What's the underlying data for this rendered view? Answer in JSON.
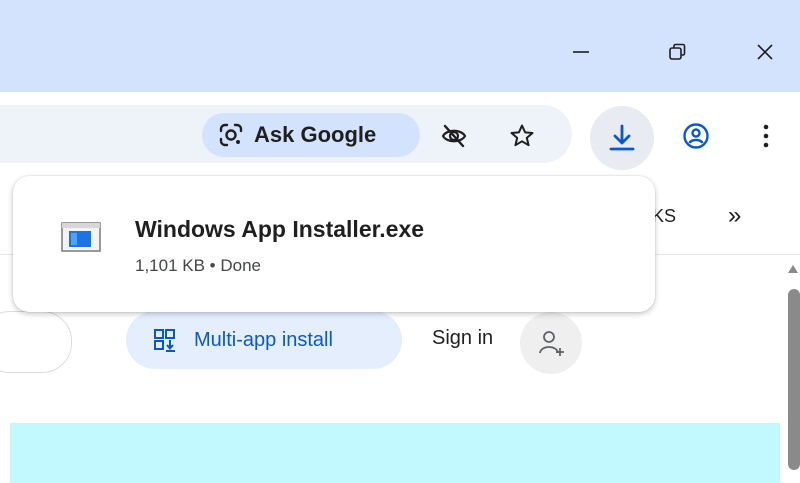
{
  "window": {
    "minimize_icon": "minimize-icon",
    "restore_icon": "restore-icon",
    "close_icon": "close-icon"
  },
  "toolbar": {
    "ask_google_label": "Ask Google",
    "ask_google_icon": "google-lens-icon",
    "icons": [
      "eye-off-icon",
      "star-icon",
      "download-icon",
      "account-icon",
      "more-vert-icon"
    ]
  },
  "bookmarks": {
    "partial_label": "KS",
    "overflow_label": "»"
  },
  "download_popup": {
    "file_name": "Windows App Installer.exe",
    "file_meta": "1,101 KB • Done"
  },
  "page": {
    "multi_app_label": "Multi-app install",
    "sign_in_label": "Sign in"
  },
  "colors": {
    "titlebar_bg": "#d3e3fd",
    "omnibox_bg": "#eef2f9",
    "accent_blue": "#0b57d0",
    "multi_app_bg": "#e4eefc",
    "banner_bg": "#c2f9ff"
  }
}
